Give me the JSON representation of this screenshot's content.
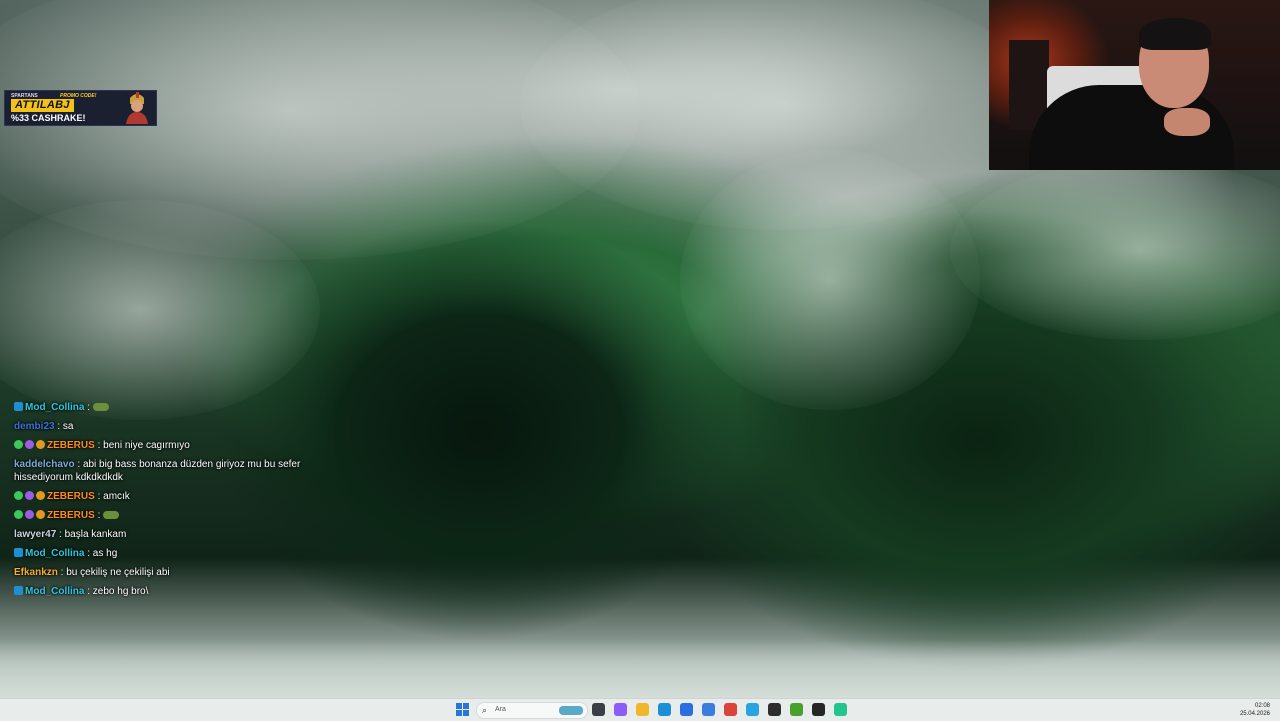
{
  "promo": {
    "brand": "SPARTANS",
    "code_label": "PROMO CODE!",
    "code": "ATTILABJ",
    "cashrake": "%33 CASHRAKE!"
  },
  "chat": [
    {
      "user": "Mod_Collina",
      "user_color": "#2ec6e0",
      "badges": [
        "mod"
      ],
      "text": "",
      "emote": true
    },
    {
      "user": "dembi23",
      "user_color": "#3d6fd8",
      "badges": [],
      "text": "sa"
    },
    {
      "user": "ZEBERUS",
      "user_color": "#ff8c1a",
      "badges": [
        "green",
        "purple",
        "orange"
      ],
      "text": "beni niye cagırmıyo"
    },
    {
      "user": "kaddelchavo",
      "user_color": "#7fa8d8",
      "badges": [],
      "text": "abi big bass bonanza düzden giriyoz mu bu sefer hissediyorum kdkdkdkdk"
    },
    {
      "user": "ZEBERUS",
      "user_color": "#ff8c1a",
      "badges": [
        "green",
        "purple",
        "orange"
      ],
      "text": "amcık"
    },
    {
      "user": "ZEBERUS",
      "user_color": "#ff8c1a",
      "badges": [
        "green",
        "purple",
        "orange"
      ],
      "text": "",
      "emote": true
    },
    {
      "user": "lawyer47",
      "user_color": "#c7d3e0",
      "badges": [],
      "text": "başla kankam"
    },
    {
      "user": "Mod_Collina",
      "user_color": "#2ec6e0",
      "badges": [
        "mod"
      ],
      "text": "as hg"
    },
    {
      "user": "Efkankzn",
      "user_color": "#f0b030",
      "badges": [],
      "text": "bu çekiliş ne çekilişi abi"
    },
    {
      "user": "Mod_Collina",
      "user_color": "#2ec6e0",
      "badges": [
        "mod"
      ],
      "text": "zebo hg bro\\"
    }
  ],
  "taskbar": {
    "search_placeholder": "Ara",
    "time": "02:08",
    "date": "25.04.2026",
    "icons": [
      {
        "name": "task-view-icon",
        "color": "#3a3f44"
      },
      {
        "name": "copilot-icon",
        "color": "#8b5cf6"
      },
      {
        "name": "file-explorer-icon",
        "color": "#f1b72c"
      },
      {
        "name": "edge-icon",
        "color": "#1a8fd6"
      },
      {
        "name": "store-icon",
        "color": "#2b6ee0"
      },
      {
        "name": "app-icon-blue",
        "color": "#3b7ddd"
      },
      {
        "name": "chrome-icon",
        "color": "#db4437"
      },
      {
        "name": "telegram-icon",
        "color": "#2aa4df"
      },
      {
        "name": "app-icon-dark",
        "color": "#2d2d2d"
      },
      {
        "name": "nvidia-icon",
        "color": "#4aa02c"
      },
      {
        "name": "obs-icon",
        "color": "#262626"
      },
      {
        "name": "app-icon-green",
        "color": "#23c48e"
      }
    ]
  }
}
